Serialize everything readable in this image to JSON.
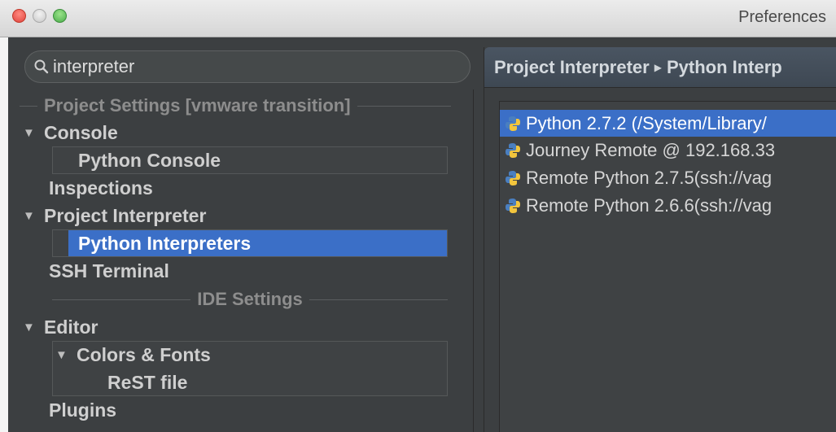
{
  "window": {
    "title": "Preferences"
  },
  "search": {
    "value": "interpreter"
  },
  "tree": {
    "project_section": "Project Settings [vmware transition]",
    "console": "Console",
    "python_console": "Python Console",
    "inspections": "Inspections",
    "project_interpreter": "Project Interpreter",
    "python_interpreters": "Python Interpreters",
    "ssh_terminal": "SSH Terminal",
    "ide_section": "IDE Settings",
    "editor": "Editor",
    "colors_fonts": "Colors & Fonts",
    "rest_file": "ReST file",
    "plugins": "Plugins"
  },
  "breadcrumb": {
    "first": "Project Interpreter",
    "second": "Python Interp"
  },
  "interpreters": [
    {
      "label": "Python 2.7.2 (/System/Library/",
      "selected": true
    },
    {
      "label": "Journey Remote @ 192.168.33",
      "selected": false
    },
    {
      "label": "Remote Python 2.7.5(ssh://vag",
      "selected": false
    },
    {
      "label": "Remote Python 2.6.6(ssh://vag",
      "selected": false
    }
  ],
  "colors": {
    "selection": "#3b6fc7",
    "background": "#3c3f41",
    "text": "#cfcfcf"
  }
}
